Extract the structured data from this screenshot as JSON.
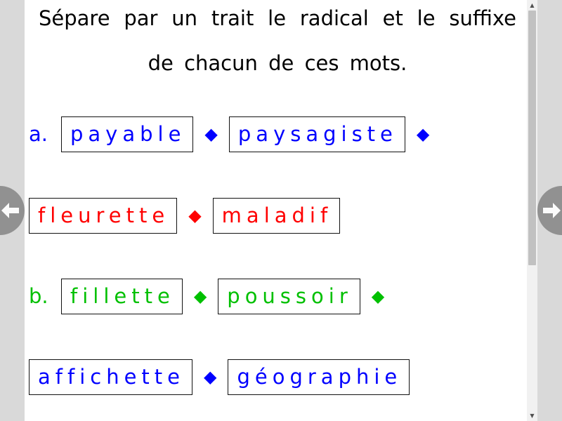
{
  "instruction": {
    "line1": "Sépare par un trait le radical et le suffixe",
    "line2": "de chacun de ces mots."
  },
  "colors": {
    "blue": "#0000ff",
    "red": "#ff0000",
    "green": "#00c000",
    "diamond_blue": "#0000ff",
    "diamond_red": "#ff0000",
    "diamond_green": "#00c000"
  },
  "rows": [
    {
      "label": "a.",
      "color": "blue",
      "words": [
        "payable",
        "paysagiste"
      ],
      "diamonds": 2
    },
    {
      "label": "",
      "color": "red",
      "words": [
        "fleurette",
        "maladif"
      ],
      "diamonds": 1
    },
    {
      "label": "b.",
      "color": "green",
      "words": [
        "fillette",
        "poussoir"
      ],
      "diamonds": 2
    },
    {
      "label": "",
      "color": "blue",
      "words": [
        "affichette",
        "géographie"
      ],
      "diamonds": 1
    }
  ],
  "diamond_glyph": "◆",
  "nav": {
    "prev_icon": "arrow-left-icon",
    "next_icon": "arrow-right-icon"
  },
  "scrollbar": {
    "up_glyph": "▲",
    "down_glyph": "▼"
  }
}
